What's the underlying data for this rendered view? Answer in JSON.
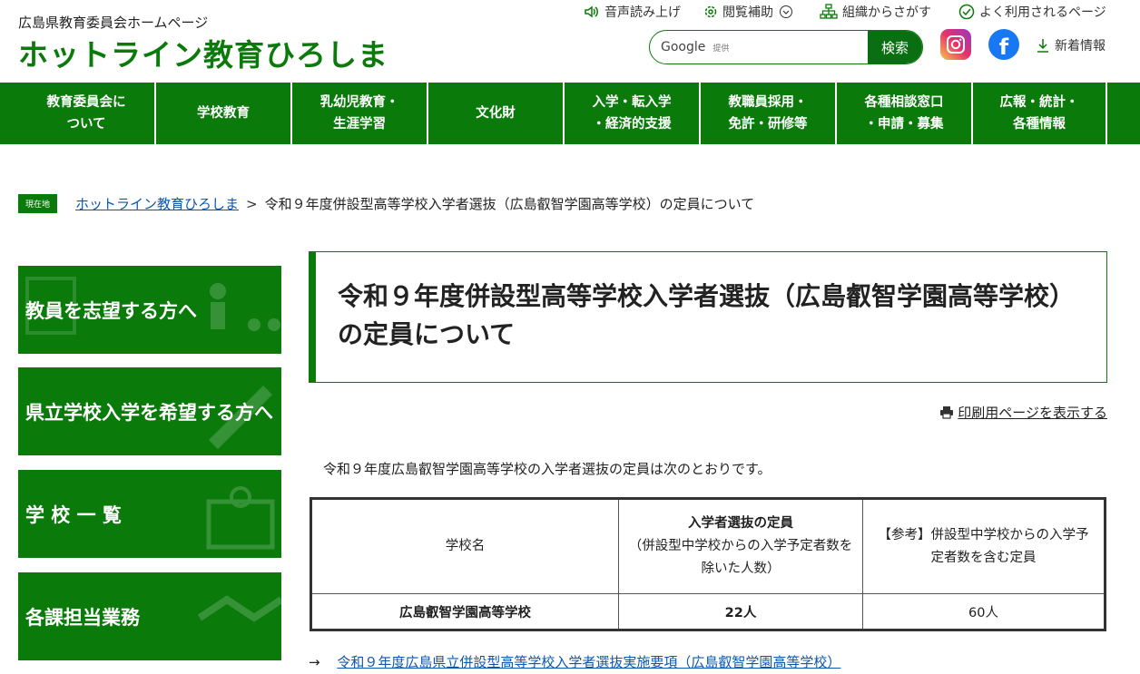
{
  "header": {
    "site_sub": "広島県教育委員会ホームページ",
    "site_title": "ホットライン教育ひろしま",
    "utility": [
      {
        "label": "音声読み上げ",
        "icon": "speaker-icon"
      },
      {
        "label": "閲覧補助",
        "icon": "gear-icon"
      },
      {
        "label": "組織からさがす",
        "icon": "org-chart-icon"
      },
      {
        "label": "よく利用されるページ",
        "icon": "check-circle-icon"
      }
    ],
    "search": {
      "brand": "Google",
      "provided": "提供",
      "button": "検索"
    },
    "news_label": "新着情報"
  },
  "gnav": [
    {
      "line1": "教育委員会に",
      "line2": "ついて"
    },
    {
      "line1": "学校教育",
      "line2": ""
    },
    {
      "line1": "乳幼児教育・",
      "line2": "生涯学習"
    },
    {
      "line1": "文化財",
      "line2": ""
    },
    {
      "line1": "入学・転入学",
      "line2": "・経済的支援"
    },
    {
      "line1": "教職員採用・",
      "line2": "免許・研修等"
    },
    {
      "line1": "各種相談窓口",
      "line2": "・申請・募集"
    },
    {
      "line1": "広報・統計・",
      "line2": "各種情報"
    }
  ],
  "breadcrumb": {
    "here": "現在地",
    "home": "ホットライン教育ひろしま",
    "sep": ">",
    "current": "令和９年度併設型高等学校入学者選抜（広島叡智学園高等学校）の定員について"
  },
  "sidebar": [
    {
      "label": "教員を志望する方へ"
    },
    {
      "label": "県立学校入学を希望する方へ"
    },
    {
      "label": "学 校 一 覧"
    },
    {
      "label": "各課担当業務"
    }
  ],
  "main": {
    "title": "令和９年度併設型高等学校入学者選抜（広島叡智学園高等学校）の定員について",
    "print_label": "印刷用ページを表示する",
    "intro": "令和９年度広島叡智学園高等学校の入学者選抜の定員は次のとおりです。",
    "table": {
      "h1": "学校名",
      "h2_bold": "入学者選抜の定員",
      "h2_sub": "（併設型中学校からの入学予定者数を除いた人数）",
      "h3": "【参考】併設型中学校からの入学予定者数を含む定員",
      "row": {
        "school": "広島叡智学園高等学校",
        "capacity": "22人",
        "total": "60人"
      }
    },
    "related_arrow": "→",
    "related_link": "令和９年度広島県立併設型高等学校入学者選抜実施要項（広島叡智学園高等学校）"
  },
  "colors": {
    "brand_green": "#0a7a0a",
    "link_blue": "#0b57b0"
  }
}
